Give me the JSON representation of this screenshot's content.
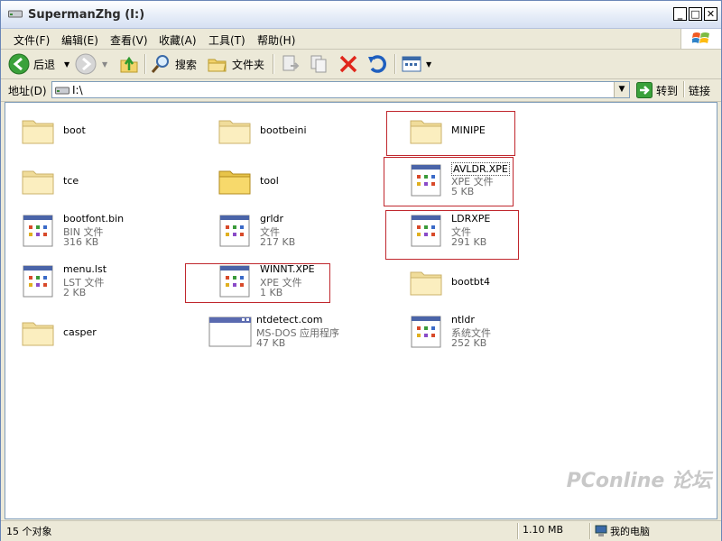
{
  "window": {
    "title": "SupermanZhg (I:)"
  },
  "menu": [
    "文件(F)",
    "编辑(E)",
    "查看(V)",
    "收藏(A)",
    "工具(T)",
    "帮助(H)"
  ],
  "toolbar": {
    "back": "后退",
    "search": "搜索",
    "folders": "文件夹"
  },
  "address": {
    "label": "地址(D)",
    "value": "I:\\",
    "go": "转到",
    "links": "链接"
  },
  "files": [
    {
      "name": "boot",
      "kind": "folder"
    },
    {
      "name": "bootbeini",
      "kind": "folder"
    },
    {
      "name": "MINIPE",
      "kind": "folder"
    },
    {
      "name": "tce",
      "kind": "folder"
    },
    {
      "name": "tool",
      "kind": "folder-yellow"
    },
    {
      "name": "AVLDR.XPE",
      "type": "XPE 文件",
      "size": "5 KB",
      "kind": "file"
    },
    {
      "name": "bootfont.bin",
      "type": "BIN 文件",
      "size": "316 KB",
      "kind": "file"
    },
    {
      "name": "grldr",
      "type": "文件",
      "size": "217 KB",
      "kind": "file"
    },
    {
      "name": "LDRXPE",
      "type": "文件",
      "size": "291 KB",
      "kind": "file"
    },
    {
      "name": "menu.lst",
      "type": "LST 文件",
      "size": "2 KB",
      "kind": "file"
    },
    {
      "name": "WINNT.XPE",
      "type": "XPE 文件",
      "size": "1 KB",
      "kind": "file"
    },
    {
      "name": "bootbt4",
      "kind": "folder"
    },
    {
      "name": "casper",
      "kind": "folder"
    },
    {
      "name": "ntdetect.com",
      "type": "MS-DOS 应用程序",
      "size": "47 KB",
      "kind": "app"
    },
    {
      "name": "ntldr",
      "type": "系统文件",
      "size": "252 KB",
      "kind": "file"
    }
  ],
  "status": {
    "count": "15 个对象",
    "size": "1.10 MB",
    "location": "我的电脑"
  },
  "watermark": "PConline 论坛",
  "colors": {
    "highlight": "#c0272d",
    "title_bg": "#e6edf8"
  }
}
